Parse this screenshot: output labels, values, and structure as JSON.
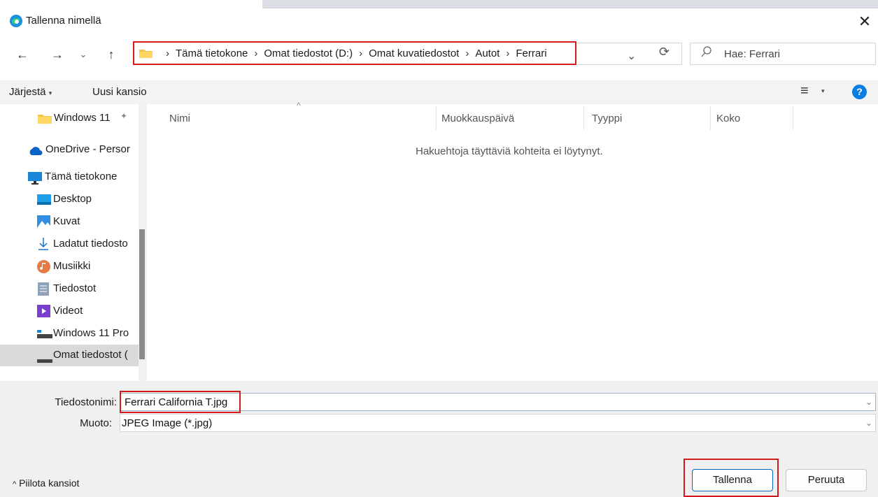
{
  "window": {
    "title": "Tallenna nimellä",
    "close": "✕"
  },
  "nav": {
    "back": "←",
    "forward": "→",
    "recent": "⌄",
    "up": "↑"
  },
  "address": {
    "crumbs": [
      "Tämä tietokone",
      "Omat tiedostot (D:)",
      "Omat kuvatiedostot",
      "Autot",
      "Ferrari"
    ],
    "separator": "›",
    "dropdown": "⌄",
    "refresh": "⟳"
  },
  "search": {
    "icon": "⚲",
    "placeholder": "Hae: Ferrari"
  },
  "toolbar": {
    "organize": "Järjestä",
    "organize_caret": "▾",
    "new_folder": "Uusi kansio",
    "view_icon": "≡",
    "view_caret": "▾",
    "help": "?"
  },
  "sidebar": {
    "items": [
      {
        "label": "Windows 11",
        "icon": "folder-icon",
        "pin": "📌"
      },
      {
        "label": "OneDrive - Persor",
        "icon": "cloud-icon"
      },
      {
        "label": "Tämä tietokone",
        "icon": "computer-icon"
      },
      {
        "label": "Desktop",
        "icon": "desktop-icon"
      },
      {
        "label": "Kuvat",
        "icon": "pictures-icon"
      },
      {
        "label": "Ladatut tiedosto",
        "icon": "download-icon"
      },
      {
        "label": "Musiikki",
        "icon": "music-icon"
      },
      {
        "label": "Tiedostot",
        "icon": "documents-icon"
      },
      {
        "label": "Videot",
        "icon": "videos-icon"
      },
      {
        "label": "Windows 11 Pro",
        "icon": "drive-icon"
      },
      {
        "label": "Omat tiedostot (",
        "icon": "drive-icon"
      }
    ]
  },
  "columns": [
    "Nimi",
    "Muokkauspäivä",
    "Tyyppi",
    "Koko"
  ],
  "empty_message": "Hakuehtoja täyttäviä kohteita ei löytynyt.",
  "form": {
    "filename_label": "Tiedostonimi:",
    "filename_value": "Ferrari California T.jpg",
    "type_label": "Muoto:",
    "type_value": "JPEG Image (*.jpg)"
  },
  "footer": {
    "hide_folders": "Piilota kansiot",
    "hide_caret": "^",
    "save": "Tallenna",
    "cancel": "Peruuta"
  },
  "colors": {
    "accent": "#0067c0",
    "highlight": "#d31b1b"
  }
}
